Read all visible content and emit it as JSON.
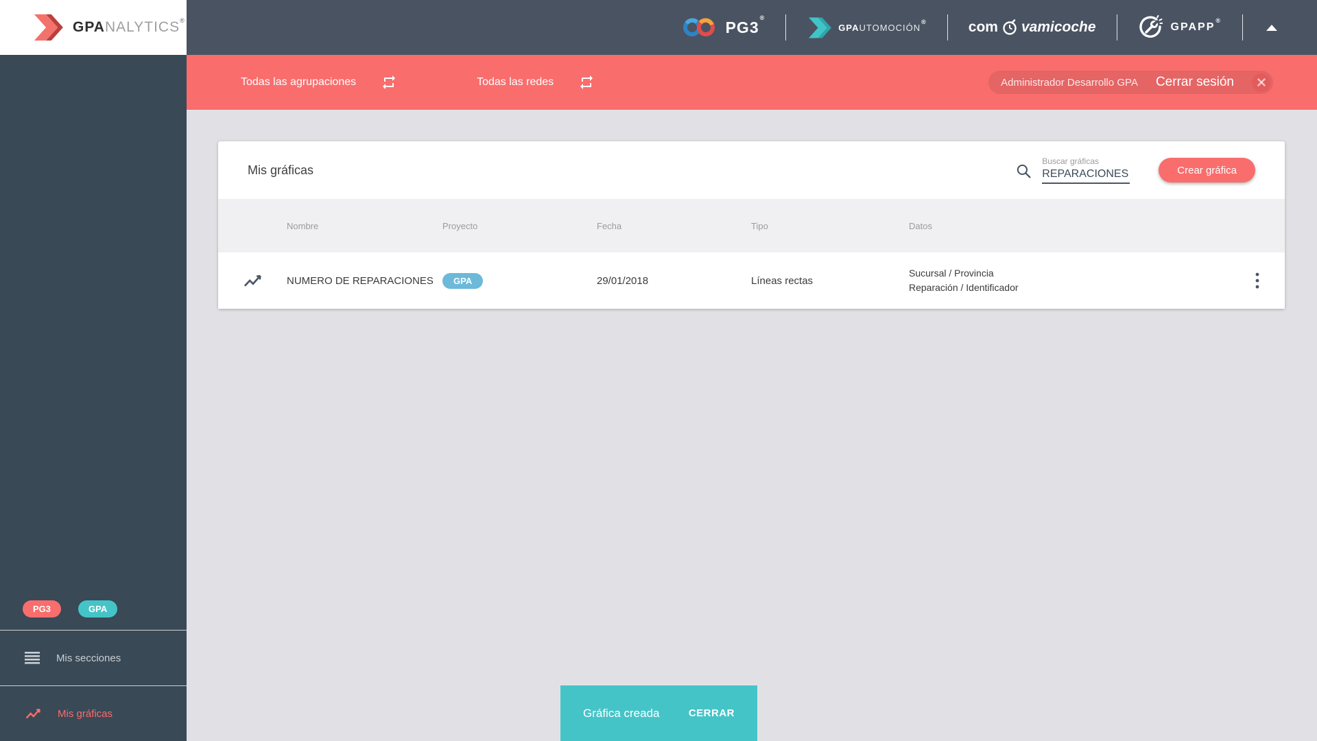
{
  "colors": {
    "coral": "#F96D6D",
    "teal": "#45C4C8",
    "badge_blue": "#6CB9D9",
    "sidebar_bg": "#394956",
    "topbar_bg": "#4A5362",
    "main_bg": "#E1E1E5"
  },
  "icons": {
    "gpa_logo": "double-chevron-arrow",
    "search": "magnifier",
    "swap": "repeat-arrows",
    "menu": "hamburger-lines",
    "chart": "line-chart",
    "kebab": "vertical-dots",
    "logout": "close-circle",
    "collapse": "up-triangle",
    "stopwatch": "clock",
    "gpaapp": "wrench-in-circle"
  },
  "sidebar": {
    "logo": {
      "bold": "GPA",
      "light": "NALYTICS",
      "reg": "®"
    },
    "badges": [
      {
        "label": "PG3"
      },
      {
        "label": "GPA"
      }
    ],
    "items": [
      {
        "label": "Mis secciones",
        "active": false
      },
      {
        "label": "Mis gráficas",
        "active": true
      }
    ]
  },
  "topbar": {
    "brands": {
      "pg3": {
        "label": "PG3",
        "reg": "®"
      },
      "automocion": {
        "bold": "GPA",
        "rest": "UTOMOCIÓN",
        "reg": "®"
      },
      "comprova": {
        "part1": "com",
        "part2": "vamicoche"
      },
      "gpaapp": {
        "label": "GPAPP",
        "reg": "®"
      }
    }
  },
  "filterbar": {
    "groupings_label": "Todas las agrupaciones",
    "networks_label": "Todas las redes",
    "user_name": "Administrador Desarrollo GPA",
    "logout_label": "Cerrar sesión"
  },
  "main": {
    "card": {
      "title": "Mis gráficas",
      "search": {
        "label": "Buscar gráficas",
        "value": "REPARACIONES"
      },
      "create_button": "Crear gráfica",
      "table": {
        "columns": [
          "Nombre",
          "Proyecto",
          "Fecha",
          "Tipo",
          "Datos"
        ],
        "rows": [
          {
            "name": "NUMERO DE REPARACIONES",
            "project_badge": "GPA",
            "date": "29/01/2018",
            "type": "Líneas rectas",
            "data_line1": "Sucursal / Provincia",
            "data_line2": "Reparación / Identificador"
          }
        ]
      }
    },
    "snackbar": {
      "message": "Gráfica creada",
      "action": "CERRAR"
    }
  }
}
